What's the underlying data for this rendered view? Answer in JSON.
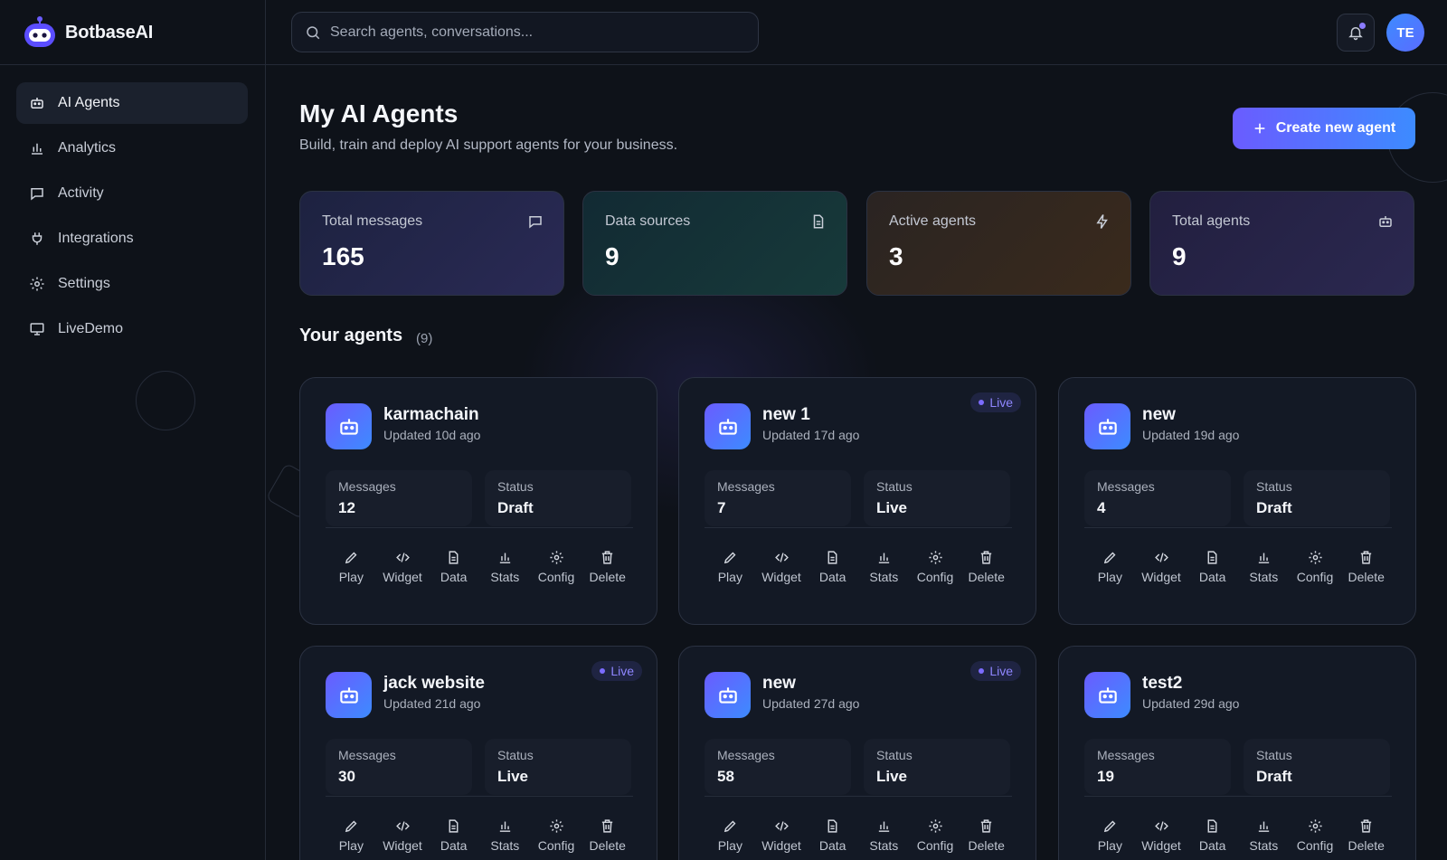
{
  "brand": {
    "name": "BotbaseAI"
  },
  "search": {
    "placeholder": "Search agents, conversations..."
  },
  "user": {
    "initials": "TE"
  },
  "sidebar": {
    "items": [
      {
        "label": "AI Agents",
        "icon": "robot-icon"
      },
      {
        "label": "Analytics",
        "icon": "bar-chart-icon"
      },
      {
        "label": "Activity",
        "icon": "message-icon"
      },
      {
        "label": "Integrations",
        "icon": "plug-icon"
      },
      {
        "label": "Settings",
        "icon": "gear-icon"
      },
      {
        "label": "LiveDemo",
        "icon": "monitor-icon"
      }
    ]
  },
  "header": {
    "title": "My AI Agents",
    "subtitle": "Build, train and deploy AI support agents for your business.",
    "create_label": "Create new agent"
  },
  "stats": [
    {
      "label": "Total messages",
      "value": "165",
      "icon": "message-icon"
    },
    {
      "label": "Data sources",
      "value": "9",
      "icon": "document-icon"
    },
    {
      "label": "Active agents",
      "value": "3",
      "icon": "lightning-icon"
    },
    {
      "label": "Total agents",
      "value": "9",
      "icon": "robot-icon"
    }
  ],
  "agents_section": {
    "title": "Your agents",
    "count": "(9)"
  },
  "metric_labels": {
    "messages": "Messages",
    "status": "Status"
  },
  "live_label": "Live",
  "actions": [
    "Play",
    "Widget",
    "Data",
    "Stats",
    "Config",
    "Delete"
  ],
  "agents": [
    {
      "name": "karmachain",
      "updated": "Updated 10d ago",
      "messages": "12",
      "status": "Draft",
      "live": false
    },
    {
      "name": "new 1",
      "updated": "Updated 17d ago",
      "messages": "7",
      "status": "Live",
      "live": true
    },
    {
      "name": "new",
      "updated": "Updated 19d ago",
      "messages": "4",
      "status": "Draft",
      "live": false
    },
    {
      "name": "jack website",
      "updated": "Updated 21d ago",
      "messages": "30",
      "status": "Live",
      "live": true
    },
    {
      "name": "new",
      "updated": "Updated 27d ago",
      "messages": "58",
      "status": "Live",
      "live": true
    },
    {
      "name": "test2",
      "updated": "Updated 29d ago",
      "messages": "19",
      "status": "Draft",
      "live": false
    }
  ],
  "colors": {
    "accent": "#6a5cff",
    "accent2": "#3d8bff",
    "bg": "#0e1219",
    "live": "#8f86ff"
  }
}
